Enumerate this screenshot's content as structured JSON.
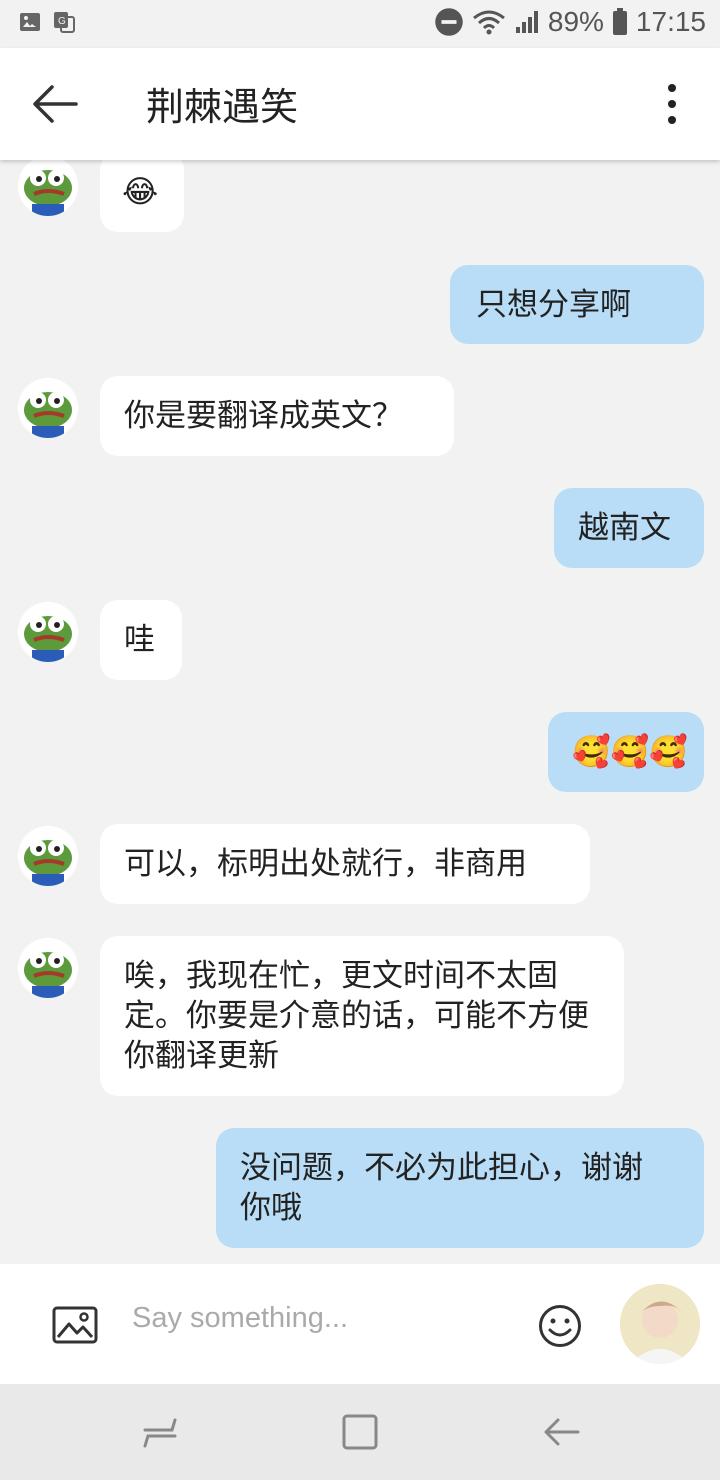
{
  "status_bar": {
    "battery": "89%",
    "time": "17:15"
  },
  "header": {
    "title": "荆棘遇笑"
  },
  "messages": [
    {
      "side": "in",
      "text": "😂"
    },
    {
      "side": "out",
      "text": "只想分享啊"
    },
    {
      "side": "in",
      "text": "你是要翻译成英文？"
    },
    {
      "side": "out",
      "text": "越南文"
    },
    {
      "side": "in",
      "text": "哇"
    },
    {
      "side": "out",
      "text": "🥰🥰🥰"
    },
    {
      "side": "in",
      "text": "可以，标明出处就行，非商用"
    },
    {
      "side": "in",
      "text": "唉，我现在忙，更文时间不太固定。你要是介意的话，可能不方便你翻译更新"
    },
    {
      "side": "out",
      "text": "没问题，不必为此担心，谢谢你哦"
    }
  ],
  "input": {
    "placeholder": "Say something..."
  },
  "colors": {
    "background": "#f2f2f2",
    "incoming_bubble": "#ffffff",
    "outgoing_bubble": "#b9ddf7",
    "navbar": "#e9e9e9"
  },
  "icons": {
    "status_left": [
      "gallery-icon",
      "translate-icon"
    ],
    "status_right": [
      "dnd-icon",
      "wifi-icon",
      "signal-icon",
      "battery-icon"
    ],
    "header": [
      "back-arrow-icon",
      "more-vert-icon"
    ],
    "input_bar": [
      "image-icon",
      "emoji-icon"
    ],
    "nav": [
      "recents-icon",
      "home-icon",
      "back-icon"
    ]
  }
}
